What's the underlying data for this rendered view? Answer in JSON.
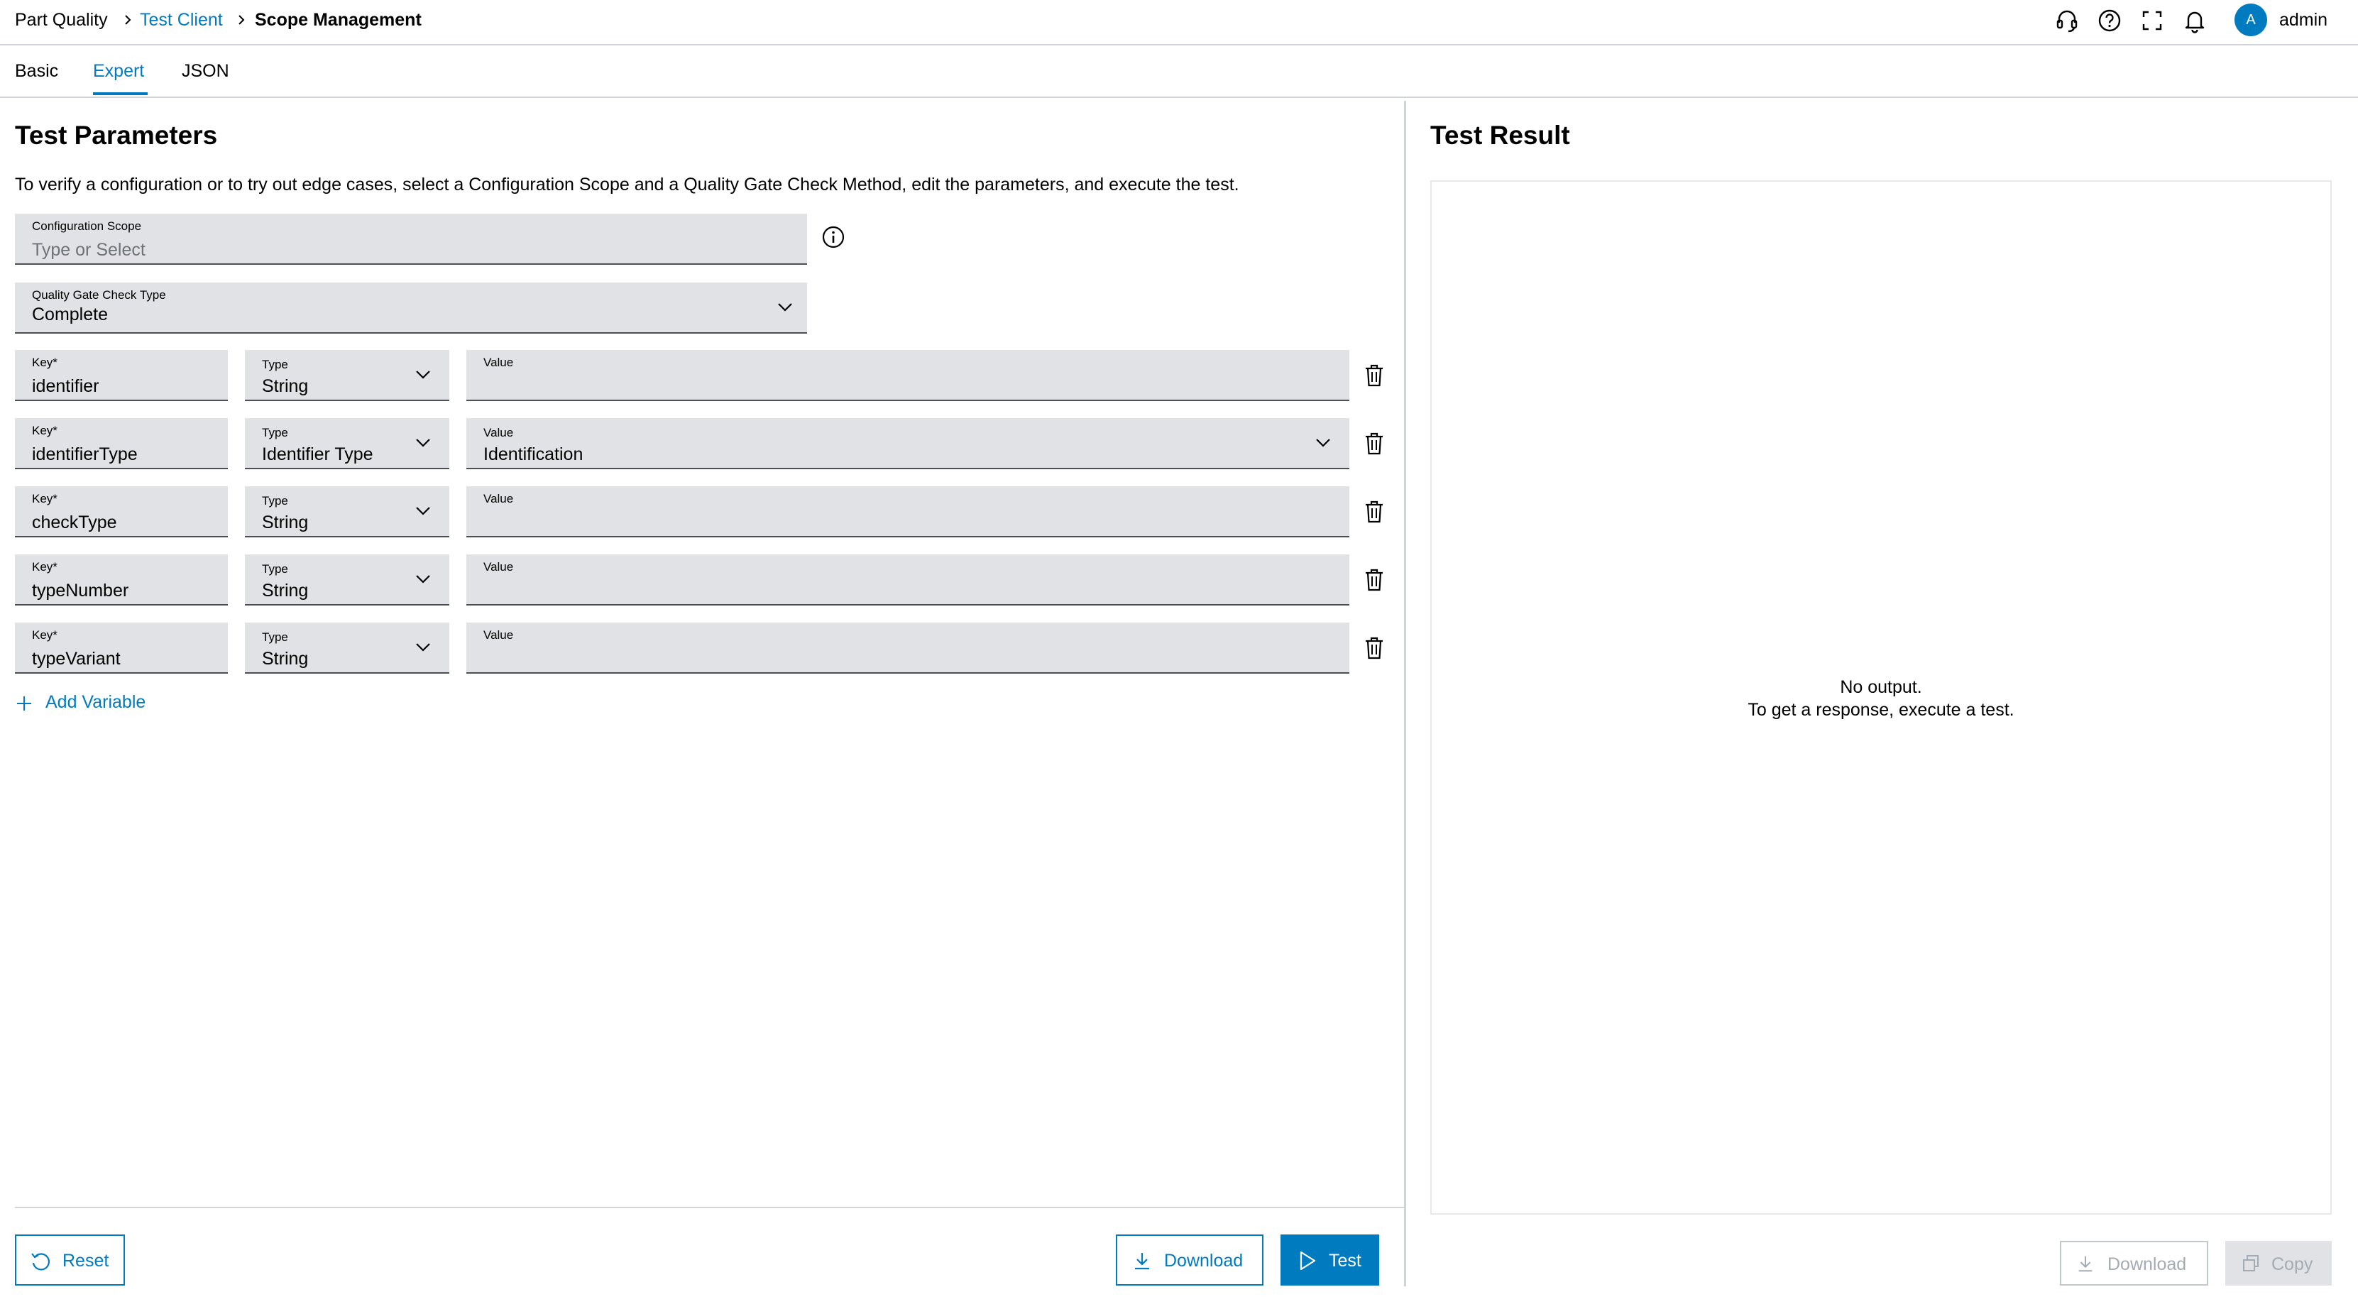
{
  "header": {
    "breadcrumb": [
      "Part Quality",
      "Test Client",
      "Scope Management"
    ],
    "username": "admin",
    "avatar_initial": "A",
    "icons": [
      "headset-icon",
      "help-icon",
      "fullscreen-icon",
      "bell-icon"
    ]
  },
  "tabs": {
    "items": [
      "Basic",
      "Expert",
      "JSON"
    ],
    "active": "Expert"
  },
  "params": {
    "title": "Test Parameters",
    "description": "To verify a configuration or to try out edge cases, select a Configuration Scope and a Quality Gate Check Method, edit the parameters, and execute the test.",
    "scope": {
      "label": "Configuration Scope",
      "placeholder": "Type or Select",
      "value": ""
    },
    "check_type": {
      "label": "Quality Gate Check Type",
      "value": "Complete"
    },
    "key_label": "Key*",
    "type_label": "Type",
    "value_label": "Value",
    "variables": [
      {
        "key": "identifier",
        "type": "String",
        "value": ""
      },
      {
        "key": "identifierType",
        "type": "Identifier Type",
        "value": "Identification"
      },
      {
        "key": "checkType",
        "type": "String",
        "value": ""
      },
      {
        "key": "typeNumber",
        "type": "String",
        "value": ""
      },
      {
        "key": "typeVariant",
        "type": "String",
        "value": ""
      }
    ],
    "add_variable": "Add Variable",
    "buttons": {
      "reset": "Reset",
      "download": "Download",
      "test": "Test"
    }
  },
  "result": {
    "title": "Test Result",
    "empty_line1": "No output.",
    "empty_line2": "To get a response, execute a test.",
    "buttons": {
      "download": "Download",
      "copy": "Copy"
    }
  },
  "colors": {
    "accent": "#007bc0",
    "field_bg": "#e0e2e5",
    "divider": "#d0d4d8",
    "disabled_text": "#a4abb3"
  }
}
